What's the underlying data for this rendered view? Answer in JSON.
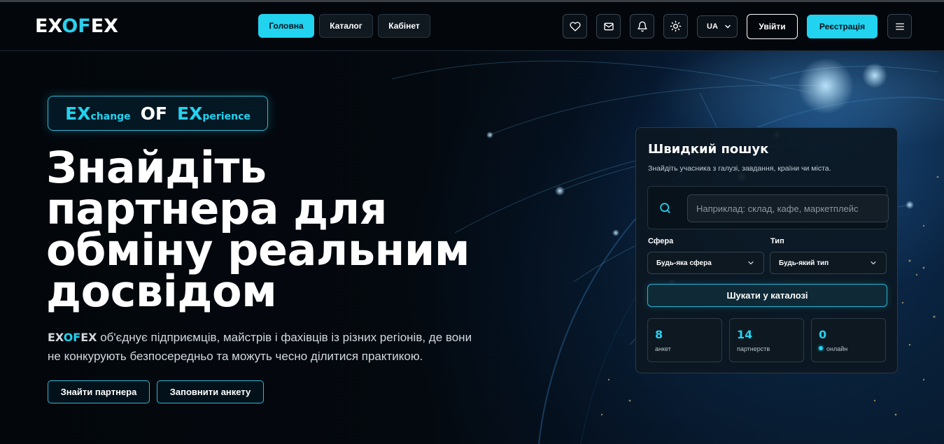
{
  "header": {
    "logo": {
      "part1": "EX",
      "part2": "OF",
      "part3": "EX"
    },
    "nav": [
      {
        "label": "Головна",
        "active": true
      },
      {
        "label": "Каталог",
        "active": false
      },
      {
        "label": "Кабінет",
        "active": false
      }
    ],
    "icons": [
      "heart-icon",
      "mail-icon",
      "bell-icon",
      "sun-icon"
    ],
    "language": "UA",
    "login_label": "Увійти",
    "register_label": "Реєстрація"
  },
  "hero": {
    "badge": {
      "ex1": "EX",
      "ex1_rest": "change",
      "of": "OF",
      "ex2": "EX",
      "ex2_rest": "perience"
    },
    "headline": "Знайдіть партнера для обміну реальним досвідом",
    "description": {
      "brand_part1": "EX",
      "brand_part2": "OF",
      "brand_part3": "EX",
      "text": " об'єднує підприємців, майстрів і фахівців із різних регіонів, де вони не конкурують безпосередньо та можуть чесно ділитися практикою."
    },
    "buttons": {
      "find_partner": "Знайти партнера",
      "fill_form": "Заповнити анкету"
    }
  },
  "quick_search": {
    "title": "Швидкий пошук",
    "subtitle": "Знайдіть учасника з галузі, завдання, країни чи міста.",
    "input_placeholder": "Наприклад: склад, кафе, маркетплейс",
    "sphere_label": "Сфера",
    "sphere_value": "Будь-яка сфера",
    "type_label": "Тип",
    "type_value": "Будь-який тип",
    "search_button": "Шукати у каталозі",
    "stats": [
      {
        "value": "8",
        "label": "анкет"
      },
      {
        "value": "14",
        "label": "партнерств"
      },
      {
        "value": "0",
        "label": "онлайн"
      }
    ]
  },
  "colors": {
    "accent": "#22d3f0",
    "background": "#04080e",
    "panel": "#0c1822"
  }
}
